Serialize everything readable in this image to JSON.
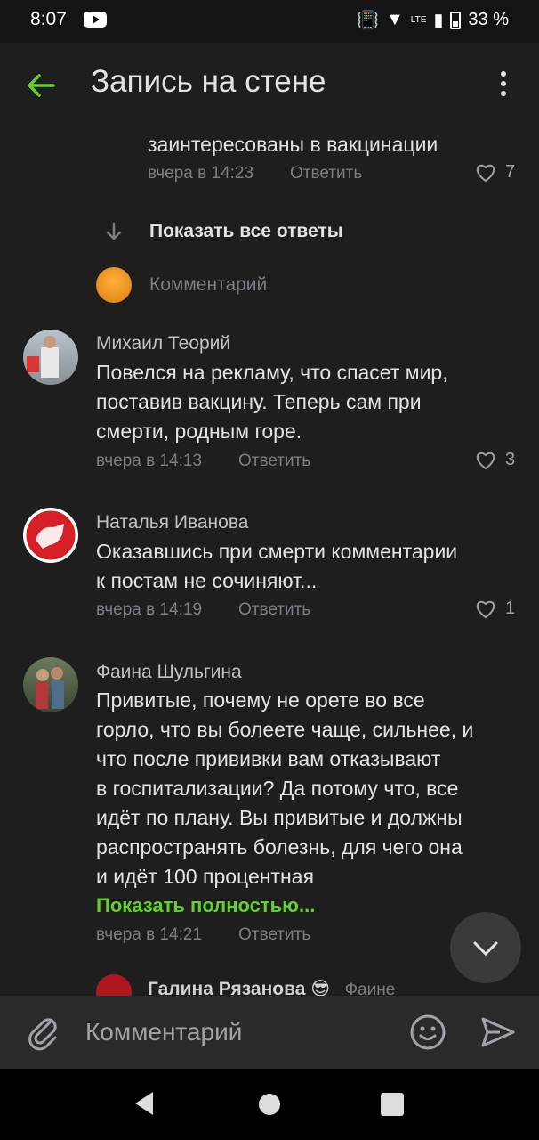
{
  "status_bar": {
    "time": "8:07",
    "battery": "33 %",
    "network": "LTE"
  },
  "header": {
    "title": "Запись на стене"
  },
  "thread": {
    "partial_reply": {
      "text_line": "заинтересованы в вакцинации",
      "time": "вчера в 14:23",
      "reply": "Ответить",
      "likes": "7"
    },
    "show_all": "Показать все ответы",
    "reply_placeholder": "Комментарий"
  },
  "comments": [
    {
      "name": "Михаил Теорий",
      "lines": [
        "Повелся на рекламу, что спасет мир,",
        "поставив вакцину. Теперь сам при",
        "смерти, родным горе."
      ],
      "time": "вчера в 14:13",
      "reply": "Ответить",
      "likes": "3"
    },
    {
      "name": "Наталья Иванова",
      "lines": [
        "Оказавшись при смерти  комментарии",
        "к постам не сочиняют..."
      ],
      "time": "вчера в 14:19",
      "reply": "Ответить",
      "likes": "1"
    },
    {
      "name": "Фаина Шульгина",
      "lines": [
        "Привитые, почему не орете во все",
        "горло, что вы болеете чаще, сильнее, и",
        "что после прививки вам отказывают",
        "в госпитализации?  Да потому что, все",
        "идёт по плану. Вы привитые и должны",
        "распространять болезнь, для чего она",
        "и идёт 100 процентная"
      ],
      "show_more": "Показать полностью...",
      "time": "вчера в 14:21",
      "reply": "Ответить"
    },
    {
      "name": "Галина Рязанова 😎",
      "reply_to": "Фаине"
    }
  ],
  "composer": {
    "placeholder": "Комментарий"
  },
  "colors": {
    "accent": "#63d12b",
    "background": "#1e1e1e"
  }
}
